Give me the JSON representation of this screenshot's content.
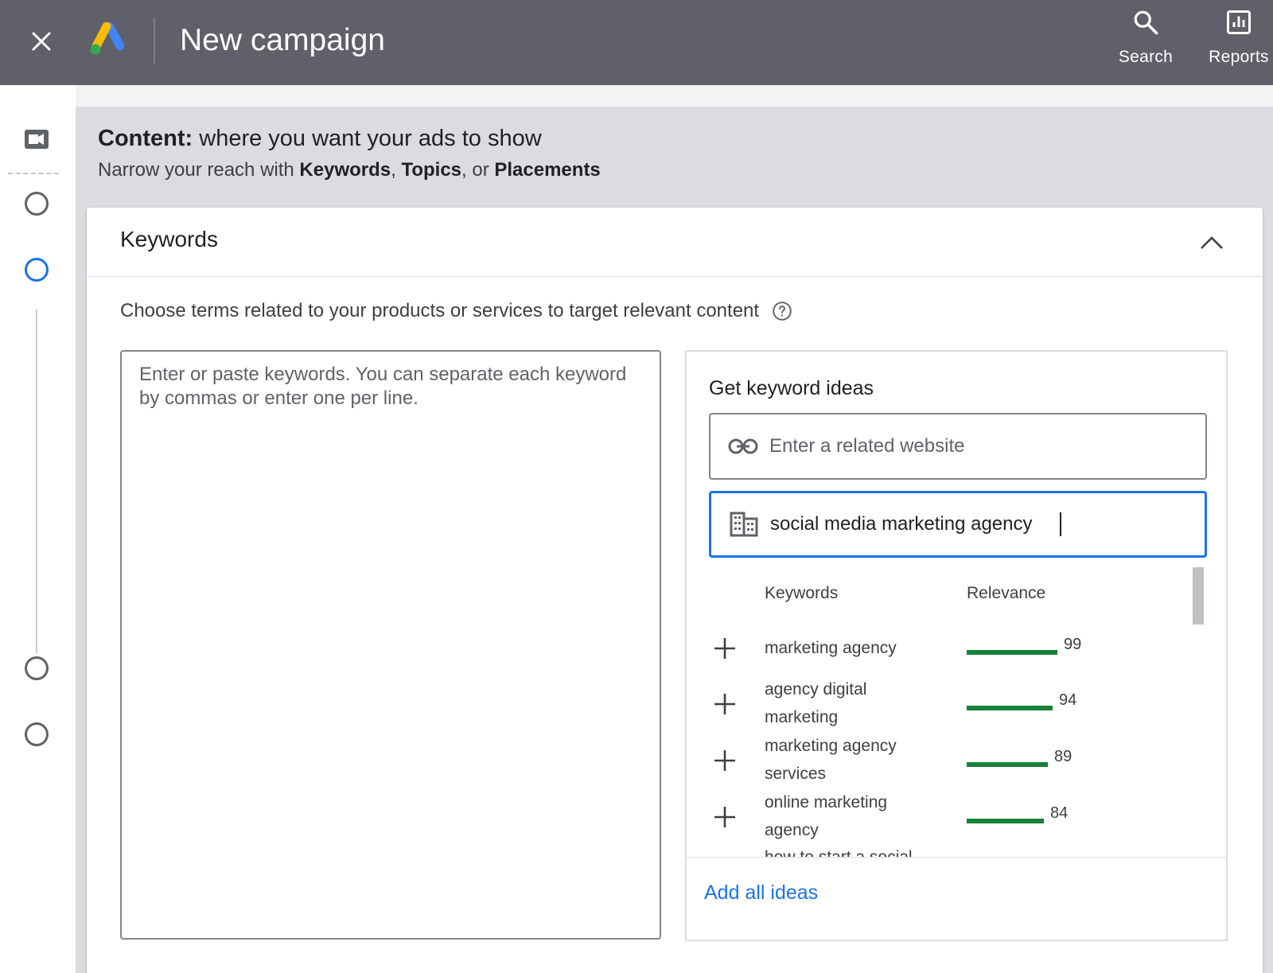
{
  "header": {
    "title": "New campaign",
    "actions": [
      {
        "label": "Search",
        "icon": "search-icon"
      },
      {
        "label": "Reports",
        "icon": "reports-icon"
      }
    ]
  },
  "content": {
    "title_bold": "Content:",
    "title_rest": " where you want your ads to show",
    "subtitle_prefix": "Narrow your reach with ",
    "subtitle_keywords": "Keywords",
    "subtitle_comma": ", ",
    "subtitle_topics": "Topics",
    "subtitle_or": ", or ",
    "subtitle_placements": "Placements"
  },
  "card": {
    "title": "Keywords",
    "description": "Choose terms related to your products or services to target relevant content",
    "textarea_placeholder": "Enter or paste keywords. You can separate each keyword by commas or enter one per line."
  },
  "ideas": {
    "title": "Get keyword ideas",
    "website_placeholder": "Enter a related website",
    "business_value": "social media marketing agency",
    "col_keywords": "Keywords",
    "col_relevance": "Relevance",
    "rows": [
      {
        "keyword": "marketing agency",
        "relevance": 99
      },
      {
        "keyword": "agency digital marketing",
        "relevance": 94
      },
      {
        "keyword": "marketing agency services",
        "relevance": 89
      },
      {
        "keyword": "online marketing agency",
        "relevance": 84
      },
      {
        "keyword": "how to start a social",
        "relevance": null
      }
    ],
    "add_all": "Add all ideas"
  },
  "colors": {
    "topbar": "#5f6069",
    "accent": "#1a73e8",
    "relevance_bar": "#188038"
  }
}
